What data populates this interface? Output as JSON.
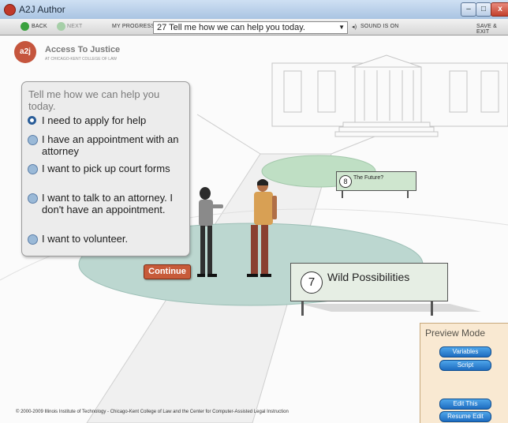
{
  "window": {
    "title": "A2J Author"
  },
  "toolbar": {
    "back_label": "BACK",
    "next_label": "NEXT",
    "progress_label": "MY PROGRESS",
    "progress_value": "27 Tell me how we can help you today.",
    "sound_label": "SOUND IS ON",
    "save_label": "SAVE & EXIT"
  },
  "logo": {
    "badge": "a2j",
    "title": "Access To Justice",
    "subtitle": "AT CHICAGO-KENT COLLEGE OF LAW"
  },
  "question": {
    "text": "Tell me how we can help you today.",
    "options": [
      {
        "label": "I need to apply for help",
        "selected": true
      },
      {
        "label": "I have an appointment with an attorney",
        "selected": false
      },
      {
        "label": "I want to pick up court forms",
        "selected": false
      },
      {
        "label": "I want to talk to an attorney. I don't have an appointment.",
        "selected": false
      },
      {
        "label": "I want to volunteer.",
        "selected": false
      }
    ],
    "continue_label": "Continue"
  },
  "signs": {
    "big": {
      "number": "7",
      "label": "Wild Possibilities"
    },
    "small": {
      "number": "8",
      "label": "The Future?"
    }
  },
  "preview": {
    "title": "Preview Mode",
    "variables_label": "Variables",
    "script_label": "Script",
    "edit_label": "Edit This",
    "resume_label": "Resume Edit"
  },
  "footer": {
    "text": "© 2000-2009 Illinois Institute of Technology - Chicago-Kent College of Law and the Center for Computer-Assisted Legal Instruction"
  },
  "colors": {
    "accent": "#c75b3a",
    "selected_radio": "#2a5d98",
    "preview_bg": "#f9e9d2"
  }
}
